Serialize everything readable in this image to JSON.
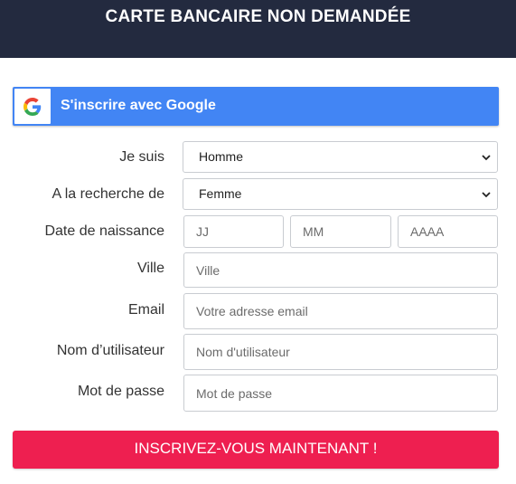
{
  "header": {
    "title": "CARTE BANCAIRE NON DEMANDÉE"
  },
  "google_button": {
    "label": "S'inscrire avec Google",
    "icon": "google-g-icon"
  },
  "form": {
    "je_suis": {
      "label": "Je suis",
      "value": "Homme"
    },
    "recherche": {
      "label": "A la recherche de",
      "value": "Femme"
    },
    "naissance": {
      "label": "Date de naissance",
      "day_placeholder": "JJ",
      "month_placeholder": "MM",
      "year_placeholder": "AAAA"
    },
    "ville": {
      "label": "Ville",
      "placeholder": "Ville"
    },
    "email": {
      "label": "Email",
      "placeholder": "Votre adresse email"
    },
    "username": {
      "label": "Nom d’utilisateur",
      "placeholder": "Nom d'utilisateur"
    },
    "password": {
      "label": "Mot de passe",
      "placeholder": "Mot de passe"
    }
  },
  "submit": {
    "label": "INSCRIVEZ-VOUS MAINTENANT !"
  },
  "colors": {
    "header_bg": "#232a3f",
    "google_blue": "#4285f4",
    "submit_red": "#ee1f50"
  }
}
